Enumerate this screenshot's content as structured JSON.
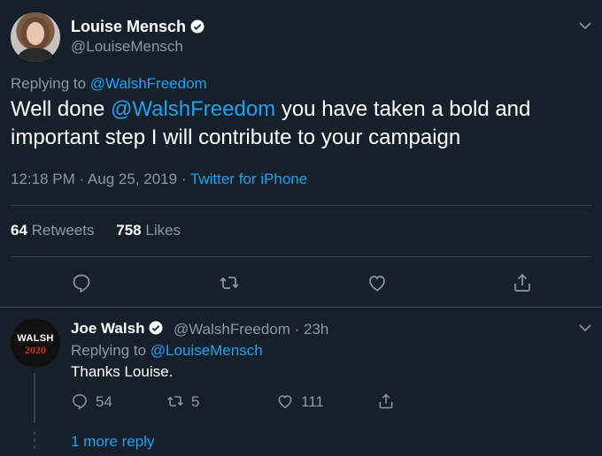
{
  "tweet": {
    "display_name": "Louise Mensch",
    "handle": "@LouiseMensch",
    "replying_prefix": "Replying to",
    "replying_to": "@WalshFreedom",
    "text_prefix": "Well done ",
    "text_mention": "@WalshFreedom",
    "text_suffix": " you have taken a bold and important step I will contribute to your campaign",
    "time": "12:18 PM · Aug 25, 2019",
    "separator": " · ",
    "source": "Twitter for iPhone",
    "retweets_count": "64",
    "retweets_label": "Retweets",
    "likes_count": "758",
    "likes_label": "Likes"
  },
  "reply": {
    "avatar_line1": "WALSH",
    "avatar_line2": "2020",
    "display_name": "Joe Walsh",
    "handle_time": "@WalshFreedom · 23h",
    "replying_prefix": "Replying to",
    "replying_to": "@LouiseMensch",
    "text": "Thanks Louise.",
    "reply_count": "54",
    "retweet_count": "5",
    "like_count": "111",
    "more_replies": "1 more reply"
  },
  "colors": {
    "background": "#15202b",
    "accent": "#1da1f2",
    "muted": "#8899a6",
    "border": "#38444d"
  },
  "icons": [
    "verified-icon",
    "chevron-down-icon",
    "reply-icon",
    "retweet-icon",
    "like-icon",
    "share-icon"
  ]
}
